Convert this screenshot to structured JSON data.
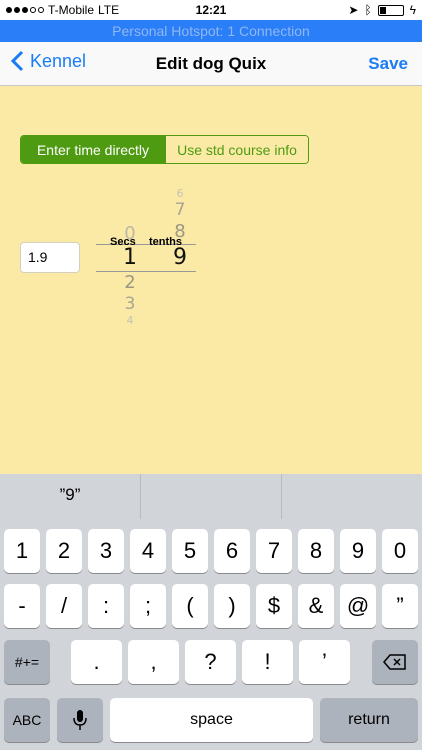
{
  "status": {
    "carrier": "T-Mobile",
    "network": "LTE",
    "time": "12:21"
  },
  "hotspot": "Personal Hotspot: 1 Connection",
  "nav": {
    "back_label": "Kennel",
    "title": "Edit dog Quix",
    "save_label": "Save"
  },
  "segment": {
    "option1": "Enter time directly",
    "option2": "Use std course info"
  },
  "time_value": "1.9",
  "picker": {
    "secs_label": "Secs",
    "tenths_label": "tenths",
    "secs_values": [
      "0",
      "1",
      "2",
      "3",
      "4"
    ],
    "tenths_values": [
      "6",
      "7",
      "8",
      "9"
    ]
  },
  "keyboard": {
    "suggestion": "”9”",
    "row1": [
      "1",
      "2",
      "3",
      "4",
      "5",
      "6",
      "7",
      "8",
      "9",
      "0"
    ],
    "row2": [
      "-",
      "/",
      ":",
      ";",
      "(",
      ")",
      "$",
      "&",
      "@",
      "”"
    ],
    "row3_left": "#+=",
    "row3": [
      ".",
      ",",
      "?",
      "!",
      "’"
    ],
    "abc_label": "ABC",
    "space_label": "space",
    "return_label": "return"
  },
  "colors": {
    "background": "#fbeaa6",
    "accent": "#4e9b12",
    "link": "#1a7cf5"
  }
}
